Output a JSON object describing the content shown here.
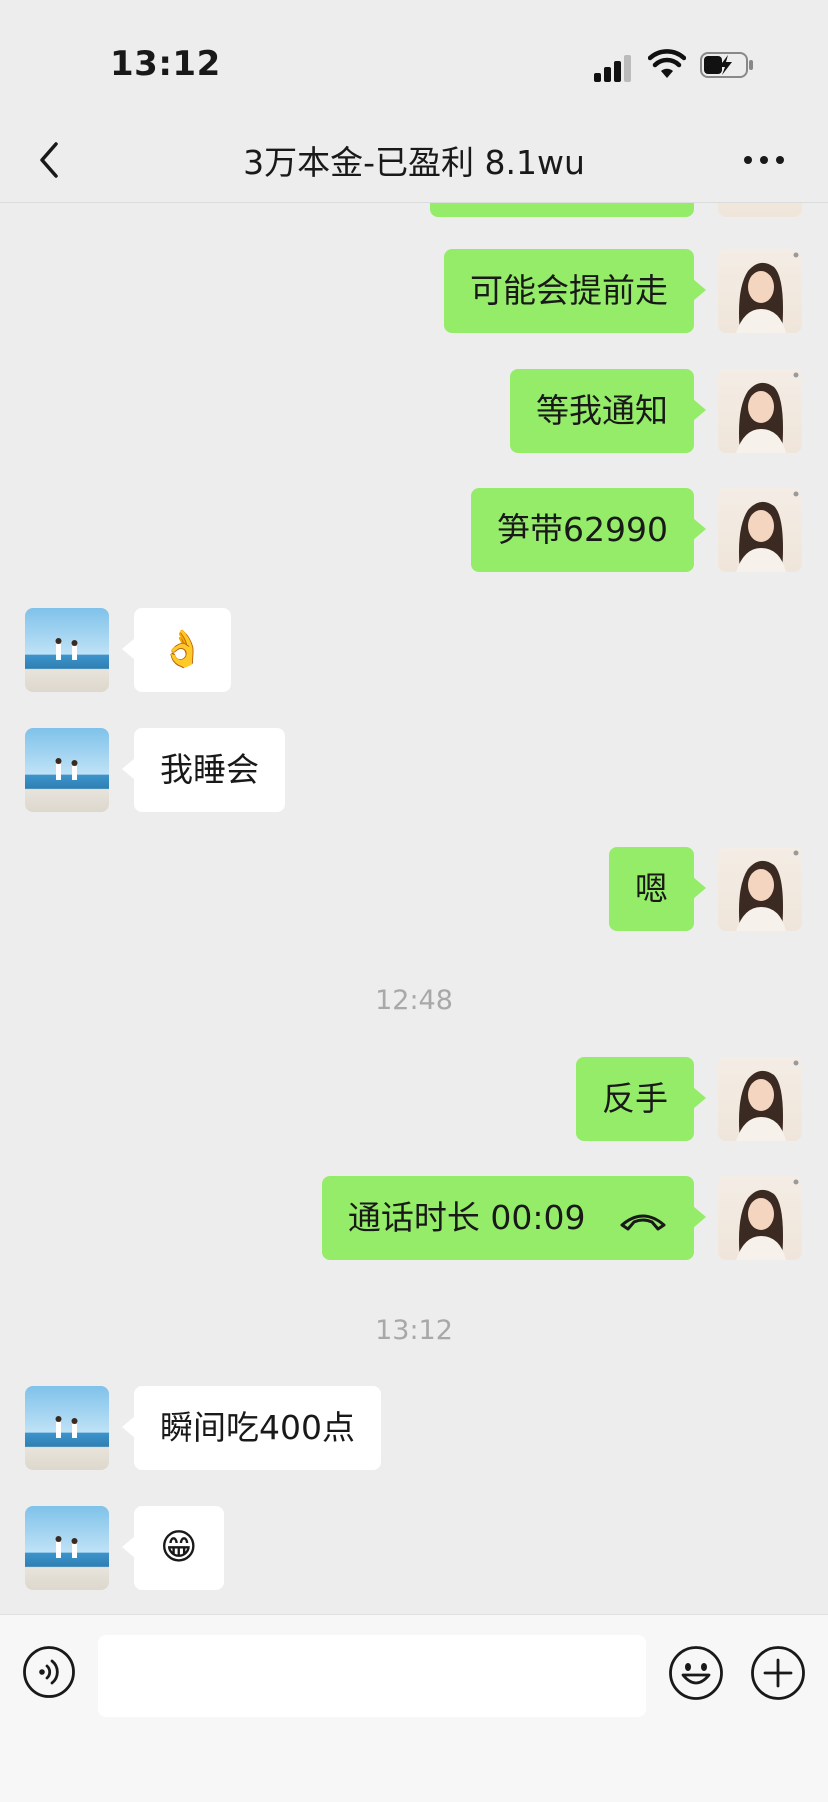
{
  "status_bar": {
    "time": "13:12"
  },
  "header": {
    "title": "3万本金-已盈利 8.1wu"
  },
  "messages": {
    "m1": {
      "text": "可能会提前走"
    },
    "m2": {
      "text": "等我通知"
    },
    "m3": {
      "text": "笋带62990"
    },
    "m4": {
      "text": "👌"
    },
    "m5": {
      "text": "我睡会"
    },
    "m6": {
      "text": "嗯"
    },
    "t1": {
      "text": "12:48"
    },
    "m7": {
      "text": "反手"
    },
    "m8": {
      "text": "通话时长 00:09",
      "icon": "phone-hangup-icon"
    },
    "t2": {
      "text": "13:12"
    },
    "m9": {
      "text": "瞬间吃400点"
    },
    "m10": {
      "text": "😁"
    }
  },
  "input_bar": {
    "value": "",
    "placeholder": ""
  },
  "colors": {
    "bubble_self": "#95EC69",
    "bubble_other": "#FFFFFF",
    "background": "#EDEDED"
  }
}
